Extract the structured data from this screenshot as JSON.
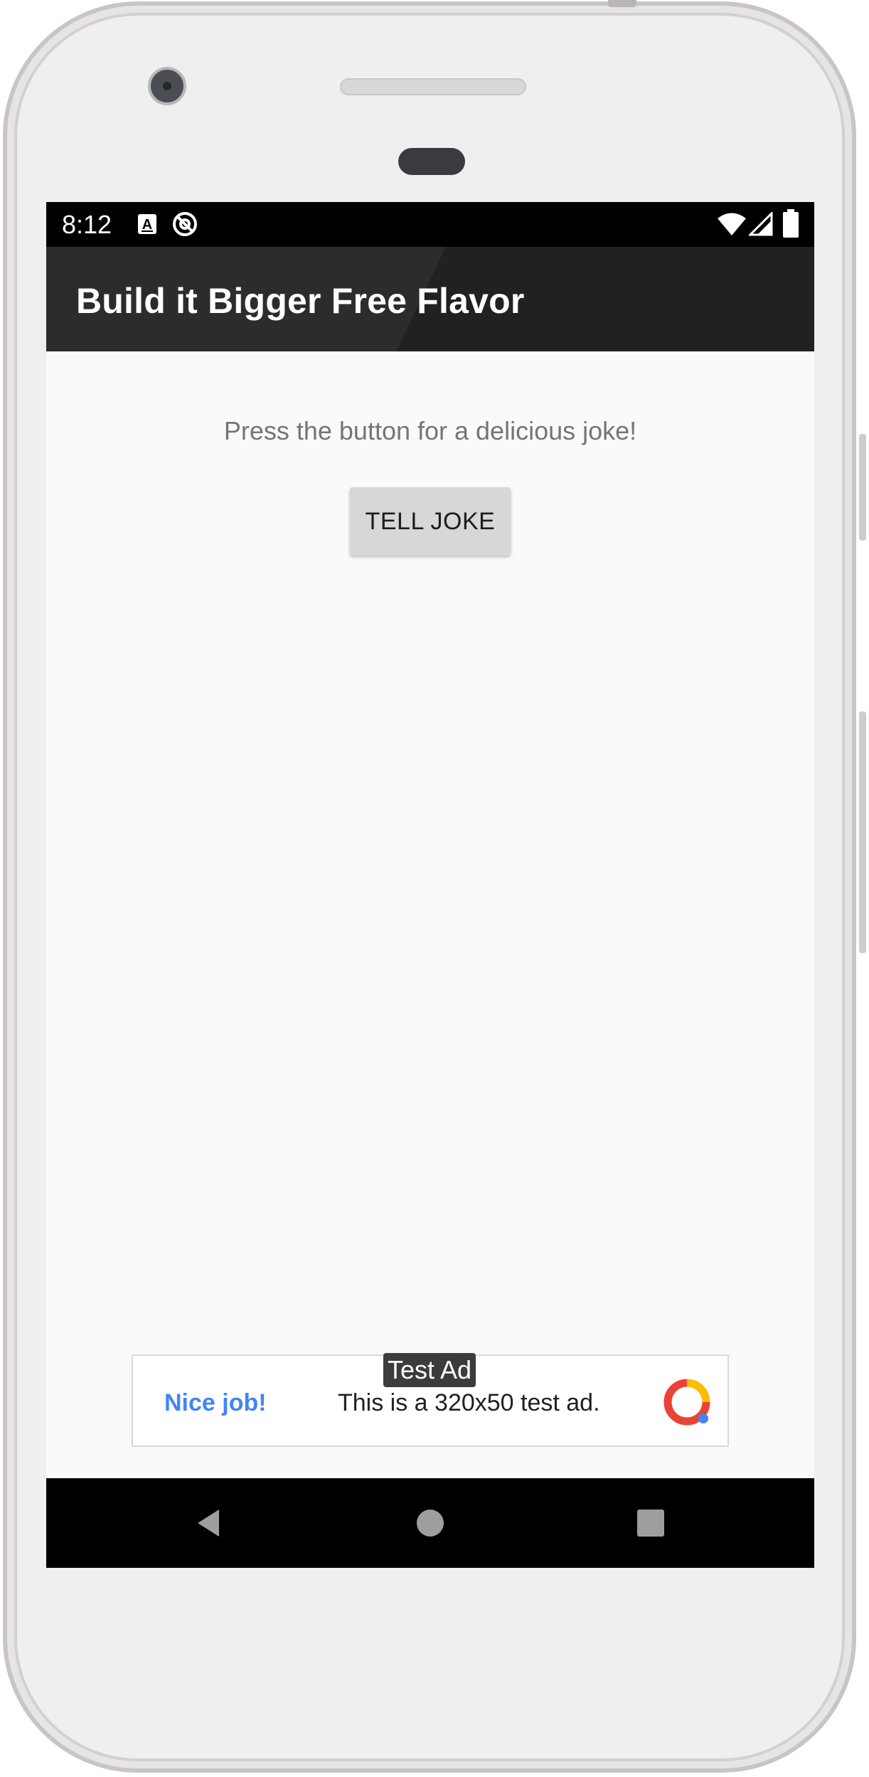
{
  "status_bar": {
    "time": "8:12",
    "icons": [
      "a-notification-icon",
      "sync-circle-icon",
      "wifi-icon",
      "cell-signal-icon",
      "battery-icon"
    ]
  },
  "app_bar": {
    "title": "Build it Bigger Free Flavor"
  },
  "main": {
    "prompt": "Press the button for a delicious joke!",
    "tell_joke_label": "TELL JOKE"
  },
  "ad": {
    "badge": "Test Ad",
    "headline": "Nice job!",
    "body": "This is a 320x50 test ad.",
    "logo_icon": "adsense-ring-icon"
  },
  "nav_bar": {
    "buttons": [
      "back-triangle-icon",
      "home-circle-icon",
      "recents-square-icon"
    ]
  },
  "colors": {
    "app_bar": "#212121",
    "screen_background": "#fafafa",
    "button": "#d6d7d7",
    "ad_headline": "#4285f4"
  }
}
